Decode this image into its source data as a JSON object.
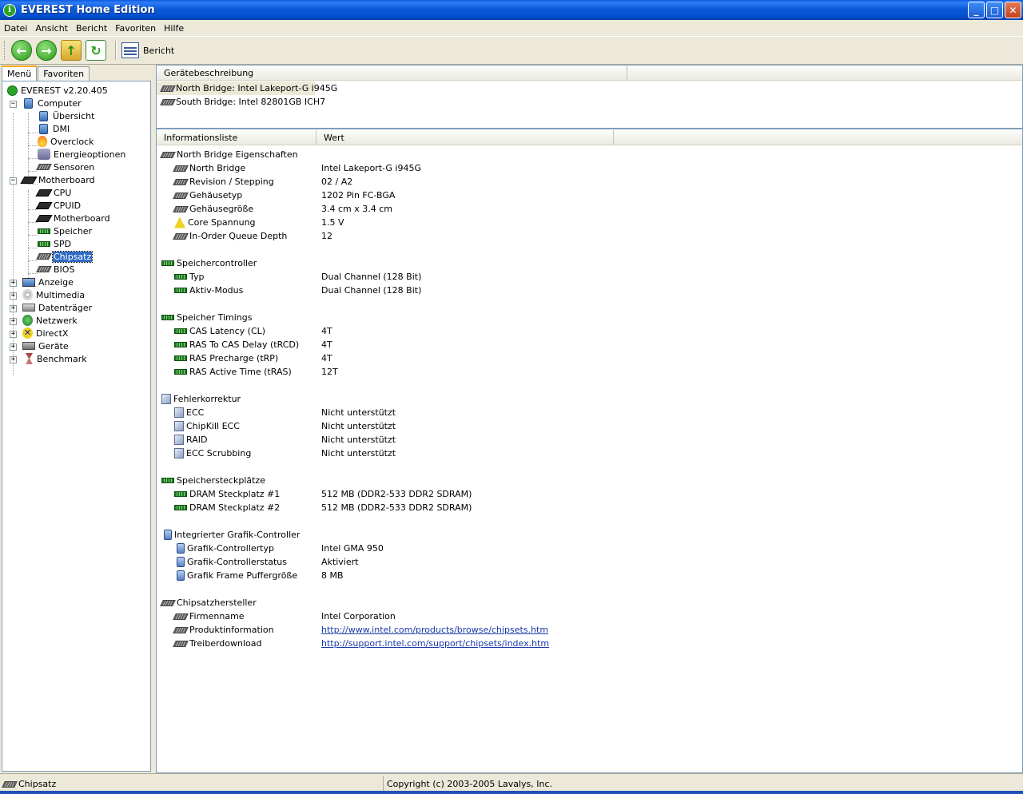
{
  "window": {
    "title": "EVEREST Home Edition"
  },
  "menu": [
    "Datei",
    "Ansicht",
    "Bericht",
    "Favoriten",
    "Hilfe"
  ],
  "toolbar": {
    "report_label": "Bericht"
  },
  "tabs": [
    "Menü",
    "Favoriten"
  ],
  "tree": {
    "root": "EVEREST v2.20.405",
    "computer": "Computer",
    "computer_children": [
      "Übersicht",
      "DMI",
      "Overclock",
      "Energieoptionen",
      "Sensoren"
    ],
    "motherboard": "Motherboard",
    "motherboard_children": [
      "CPU",
      "CPUID",
      "Motherboard",
      "Speicher",
      "SPD",
      "Chipsatz",
      "BIOS"
    ],
    "others": [
      "Anzeige",
      "Multimedia",
      "Datenträger",
      "Netzwerk",
      "DirectX",
      "Geräte",
      "Benchmark"
    ]
  },
  "device_panel": {
    "header": "Gerätebeschreibung",
    "devices": [
      "North Bridge: Intel Lakeport-G i945G",
      "South Bridge: Intel 82801GB ICH7"
    ]
  },
  "info_panel": {
    "col_field": "Informationsliste",
    "col_value": "Wert",
    "sections": [
      {
        "title": "North Bridge Eigenschaften",
        "icon": "chip",
        "rows": [
          {
            "field": "North Bridge",
            "value": "Intel Lakeport-G i945G",
            "icon": "chip"
          },
          {
            "field": "Revision / Stepping",
            "value": "02 / A2",
            "icon": "chip"
          },
          {
            "field": "Gehäusetyp",
            "value": "1202 Pin FC-BGA",
            "icon": "chip"
          },
          {
            "field": "Gehäusegröße",
            "value": "3.4 cm x 3.4 cm",
            "icon": "chip"
          },
          {
            "field": "Core Spannung",
            "value": "1.5 V",
            "icon": "warn"
          },
          {
            "field": "In-Order Queue Depth",
            "value": "12",
            "icon": "chip"
          }
        ]
      },
      {
        "title": "Speichercontroller",
        "icon": "mem",
        "rows": [
          {
            "field": "Typ",
            "value": "Dual Channel  (128 Bit)",
            "icon": "mem"
          },
          {
            "field": "Aktiv-Modus",
            "value": "Dual Channel  (128 Bit)",
            "icon": "mem"
          }
        ]
      },
      {
        "title": "Speicher Timings",
        "icon": "mem",
        "rows": [
          {
            "field": "CAS Latency (CL)",
            "value": "4T",
            "icon": "mem"
          },
          {
            "field": "RAS To CAS Delay (tRCD)",
            "value": "4T",
            "icon": "mem"
          },
          {
            "field": "RAS Precharge (tRP)",
            "value": "4T",
            "icon": "mem"
          },
          {
            "field": "RAS Active Time (tRAS)",
            "value": "12T",
            "icon": "mem"
          }
        ]
      },
      {
        "title": "Fehlerkorrektur",
        "icon": "cube",
        "rows": [
          {
            "field": "ECC",
            "value": "Nicht unterstützt",
            "icon": "cube"
          },
          {
            "field": "ChipKill ECC",
            "value": "Nicht unterstützt",
            "icon": "cube"
          },
          {
            "field": "RAID",
            "value": "Nicht unterstützt",
            "icon": "cube"
          },
          {
            "field": "ECC Scrubbing",
            "value": "Nicht unterstützt",
            "icon": "cube"
          }
        ]
      },
      {
        "title": "Speichersteckplätze",
        "icon": "mem",
        "rows": [
          {
            "field": "DRAM Steckplatz #1",
            "value": "512 MB  (DDR2-533 DDR2 SDRAM)",
            "icon": "mem"
          },
          {
            "field": "DRAM Steckplatz #2",
            "value": "512 MB  (DDR2-533 DDR2 SDRAM)",
            "icon": "mem"
          }
        ]
      },
      {
        "title": "Integrierter Grafik-Controller",
        "icon": "gpu",
        "rows": [
          {
            "field": "Grafik-Controllertyp",
            "value": "Intel GMA 950",
            "icon": "gpu"
          },
          {
            "field": "Grafik-Controllerstatus",
            "value": "Aktiviert",
            "icon": "gpu"
          },
          {
            "field": "Grafik Frame Puffergröße",
            "value": "8 MB",
            "icon": "gpu"
          }
        ]
      },
      {
        "title": "Chipsatzhersteller",
        "icon": "chip",
        "rows": [
          {
            "field": "Firmenname",
            "value": "Intel Corporation",
            "icon": "chip"
          },
          {
            "field": "Produktinformation",
            "value": "http://www.intel.com/products/browse/chipsets.htm",
            "icon": "chip",
            "link": true
          },
          {
            "field": "Treiberdownload",
            "value": "http://support.intel.com/support/chipsets/index.htm",
            "icon": "chip",
            "link": true
          }
        ]
      }
    ]
  },
  "status": {
    "left": "Chipsatz",
    "right": "Copyright (c) 2003-2005 Lavalys, Inc."
  }
}
